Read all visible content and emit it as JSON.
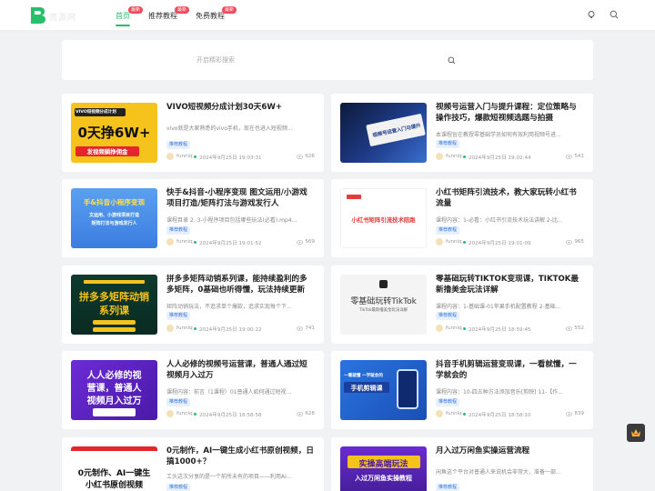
{
  "brand": {
    "logo_text": "资源网",
    "accent": "#26c06a"
  },
  "nav": [
    {
      "label": "首页",
      "badge": "最新"
    },
    {
      "label": "推荐教程",
      "badge": "最新"
    },
    {
      "label": "免费教程",
      "badge": "最新"
    }
  ],
  "search": {
    "placeholder": "开启精彩搜索"
  },
  "cards": [
    {
      "title": "VIVO短视频分成计划30天6W+",
      "excerpt": "vivo就是大家熟悉的vivo手机，现在也进入短视频...",
      "tag": "推荐教程",
      "author": "funniq",
      "date": "2024年9月25日 19:03:31",
      "views": "626",
      "thumb_lines": [
        "VIVO短视频分成计划",
        "0天挣6W+",
        "发视频躺挣佣金"
      ]
    },
    {
      "title": "视频号运营入门与提升课程：定位策略与操作技巧，爆款短视频选题与拍摄",
      "excerpt": "本课程旨在教授零基础学员如何有效利用视频号进...",
      "tag": "推荐教程",
      "author": "funniq",
      "date": "2024年9月25日 19:02:44",
      "views": "541",
      "thumb_lines": [
        "视频号运营入门与提升"
      ]
    },
    {
      "title": "快手&抖音-小程序变现 图文运用/小游戏项目打造/矩阵打法与游戏发行人",
      "excerpt": "课程目录 2. 3-小程序项目包括哪些玩法(必看).mp4...",
      "tag": "推荐教程",
      "author": "funniq",
      "date": "2024年9月25日 19:01:52",
      "views": "569",
      "thumb_lines": [
        "手&抖音小程序变现",
        "文运用、小游戏项目打造",
        "矩阵打法与游戏发行人"
      ]
    },
    {
      "title": "小红书矩阵引流技术，教大家玩转小红书流量",
      "excerpt": "课程内容：1-必看：小红书引流技术玩法讲解 2-比...",
      "tag": "推荐教程",
      "author": "funniq",
      "date": "2024年9月25日 19:01:09",
      "views": "965",
      "thumb_lines": [
        "小红书矩阵引流技术陪跑"
      ]
    },
    {
      "title": "拼多多矩阵动销系列课，能持续盈利的多多矩阵，0基础也听得懂，玩法持续更新",
      "excerpt": "矩阵动销玩法，不追求单个爆款，追求实现每个下...",
      "tag": "推荐教程",
      "author": "funniq",
      "date": "2024年9月25日 19:00:22",
      "views": "741",
      "thumb_lines": [
        "拼多多矩阵动销",
        "系列课"
      ]
    },
    {
      "title": "零基础玩转TIKTOK变现课，TIKTOK最新撸美金玩法详解",
      "excerpt": "课程内容：1-基础课-01苹果手机配置教程 2-基础...",
      "tag": "推荐教程",
      "author": "funniq",
      "date": "2024年9月25日 18:59:45",
      "views": "552",
      "thumb_lines": [
        "零基础玩转TikTok",
        "TikTok最新撸美金玩法详解"
      ]
    },
    {
      "title": "人人必修的视频号运营课，普通人通过短视频月入过万",
      "excerpt": "课程内容：前言（1课程）01普通人如何通过短视...",
      "tag": "推荐教程",
      "author": "funniq",
      "date": "2024年9月25日 18:58:58",
      "views": "628",
      "thumb_lines": [
        "人人必修的视",
        "营课，普通人",
        "视频月入过万"
      ]
    },
    {
      "title": "抖音手机剪辑运营变现课，一看就懂，一学就会的",
      "excerpt": "课程内容：10-四五种方法添加音乐[剪映] 11-【作...",
      "tag": "推荐教程",
      "author": "funniq",
      "date": "2024年9月25日 18:58:10",
      "views": "839",
      "thumb_lines": [
        "一看就懂 一学就会的",
        "手机剪辑课"
      ]
    },
    {
      "title": "0元制作，AI一键生成小红书原创视频，日搞1000+？",
      "excerpt": "工头这次分享的是一个前所未有的项目——利用AI...",
      "tag": "推荐教程",
      "author": "funniq",
      "date": "",
      "views": "",
      "thumb_lines": [
        "0元制作、AI一键生",
        "小红书原创视频"
      ]
    },
    {
      "title": "月入过万闲鱼实操运营流程",
      "excerpt": "闲鱼这个平台对普通人来说机会非常大，准备一部...",
      "tag": "推荐教程",
      "author": "funniq",
      "date": "",
      "views": "",
      "thumb_lines": [
        "实操高端玩法",
        "入过万闲鱼实操教程"
      ]
    }
  ]
}
